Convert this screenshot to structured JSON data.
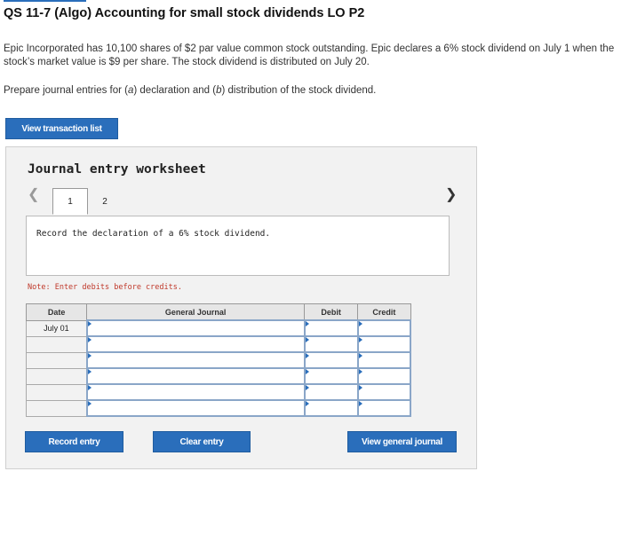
{
  "header": {
    "title": "QS 11-7 (Algo) Accounting for small stock dividends LO P2"
  },
  "problem": {
    "text": "Epic Incorporated has 10,100 shares of $2 par value common stock outstanding. Epic declares a 6% stock dividend on July 1 when the stock’s market value is $9 per share. The stock dividend is distributed on July 20.",
    "instructions": "Prepare journal entries for (a) declaration and (b) distribution of the stock dividend."
  },
  "buttons": {
    "view_transaction_list": "View transaction list",
    "record_entry": "Record entry",
    "clear_entry": "Clear entry",
    "view_general_journal": "View general journal"
  },
  "worksheet": {
    "title": "Journal entry worksheet",
    "prev_icon": "chevron-left-icon",
    "next_icon": "chevron-right-icon",
    "tabs": [
      {
        "label": "1",
        "active": true
      },
      {
        "label": "2",
        "active": false
      }
    ],
    "description": "Record the declaration of a 6% stock dividend.",
    "note": "Note: Enter debits before credits."
  },
  "journal_table": {
    "headers": {
      "date": "Date",
      "general_journal": "General Journal",
      "debit": "Debit",
      "credit": "Credit"
    },
    "rows": [
      {
        "date": "July 01",
        "account": "",
        "debit": "",
        "credit": ""
      },
      {
        "date": "",
        "account": "",
        "debit": "",
        "credit": ""
      },
      {
        "date": "",
        "account": "",
        "debit": "",
        "credit": ""
      },
      {
        "date": "",
        "account": "",
        "debit": "",
        "credit": ""
      },
      {
        "date": "",
        "account": "",
        "debit": "",
        "credit": ""
      },
      {
        "date": "",
        "account": "",
        "debit": "",
        "credit": ""
      }
    ]
  },
  "colors": {
    "accent": "#2a6ebb",
    "note": "#c0392b",
    "panel": "#f2f2f2"
  }
}
